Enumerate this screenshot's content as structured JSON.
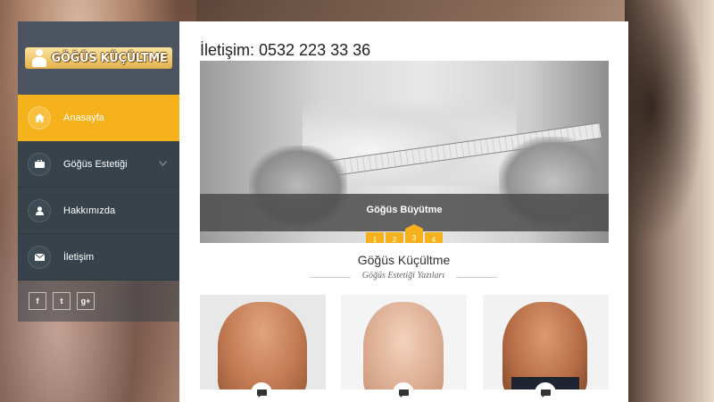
{
  "site": {
    "logo_text": "GÖĞÜS KÜÇÜLTME"
  },
  "sidebar": {
    "items": [
      {
        "label": "Anasayfa",
        "icon": "home-icon",
        "active": true
      },
      {
        "label": "Göğüs Estetiği",
        "icon": "briefcase-icon",
        "has_submenu": true
      },
      {
        "label": "Hakkımızda",
        "icon": "user-icon"
      },
      {
        "label": "İletişim",
        "icon": "envelope-icon"
      }
    ],
    "social": [
      {
        "label": "f",
        "icon": "facebook-icon"
      },
      {
        "label": "t",
        "icon": "twitter-icon"
      },
      {
        "label": "g+",
        "icon": "googleplus-icon"
      }
    ]
  },
  "main": {
    "contact_line": "İletişim: 0532 223 33 36",
    "slider": {
      "caption": "Göğüs Büyütme",
      "pages": [
        "1",
        "2",
        "3",
        "4"
      ],
      "active_page": 3
    },
    "section_title": "Göğüs Küçültme",
    "section_subtitle": "Göğüs Estetiği Yazıları",
    "cards": [
      {
        "icon": "comment-icon"
      },
      {
        "icon": "comment-icon"
      },
      {
        "icon": "comment-icon"
      }
    ]
  },
  "colors": {
    "accent": "#f5b21c",
    "sidebar_bg": "#37424a",
    "logo_bg": "#4b5460",
    "active_arrow": "#4aa3df"
  }
}
